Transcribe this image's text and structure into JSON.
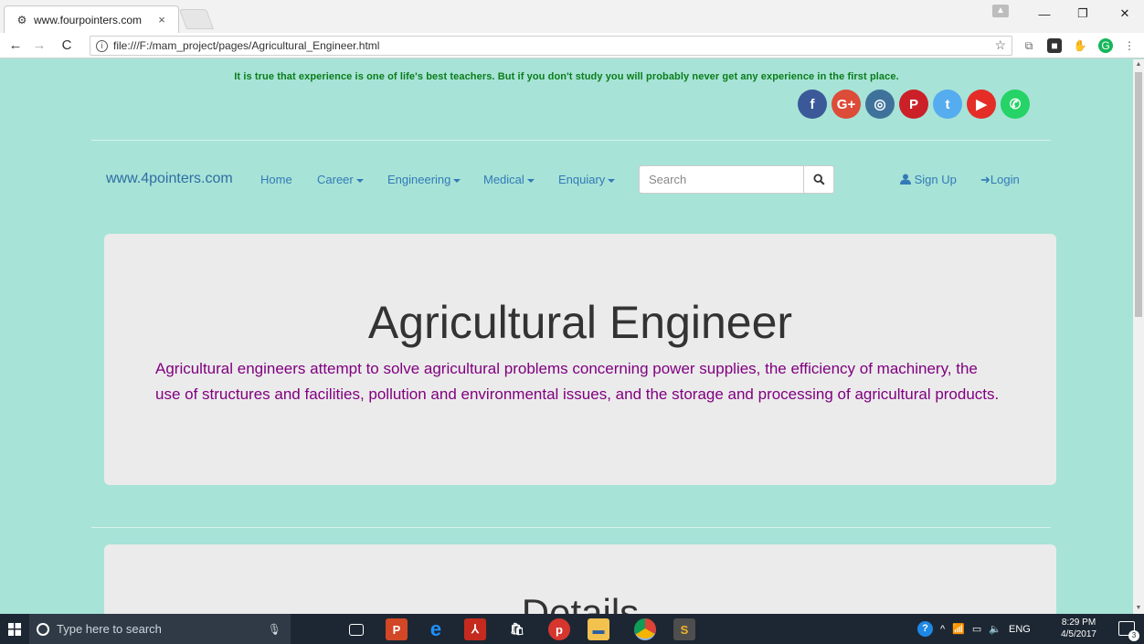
{
  "browser": {
    "tab_title": "www.fourpointers.com",
    "tab_close": "×",
    "url": "file:///F:/mam_project/pages/Agricultural_Engineer.html",
    "info_glyph": "i"
  },
  "site": {
    "quote": "It is true that experience is one of life's best teachers. But if you don't study you will probably never get any experience in the first place.",
    "social": [
      {
        "name": "facebook-icon",
        "glyph": "f",
        "color": "#3b5998"
      },
      {
        "name": "google-plus-icon",
        "glyph": "G+",
        "color": "#dd4b39"
      },
      {
        "name": "instagram-icon",
        "glyph": "◎",
        "color": "#3f729b"
      },
      {
        "name": "pinterest-icon",
        "glyph": "P",
        "color": "#cb2027"
      },
      {
        "name": "twitter-icon",
        "glyph": "t",
        "color": "#55acee"
      },
      {
        "name": "youtube-icon",
        "glyph": "▶",
        "color": "#e52d27"
      },
      {
        "name": "whatsapp-icon",
        "glyph": "✆",
        "color": "#25d366"
      }
    ]
  },
  "navbar": {
    "brand": "www.4pointers.com",
    "home": "Home",
    "career": "Career",
    "engineering": "Engineering",
    "medical": "Medical",
    "enquiry": "Enquiary",
    "search_placeholder": "Search",
    "signup": "Sign Up",
    "login": "Login"
  },
  "main": {
    "title": "Agricultural Engineer",
    "description": "Agricultural engineers attempt to solve agricultural problems concerning power supplies, the efficiency of machinery, the use of structures and facilities, pollution and environmental issues, and the storage and processing of agricultural products.",
    "details_title": "Details"
  },
  "taskbar": {
    "search_placeholder": "Type here to search",
    "lang": "ENG",
    "time": "8:29 PM",
    "date": "4/5/2017",
    "notifications": "3"
  },
  "colors": {
    "page_bg": "#a7e3d7",
    "quote": "#0a7d19",
    "link": "#337ab7",
    "description": "#800080",
    "jumbotron": "#ebebeb"
  }
}
